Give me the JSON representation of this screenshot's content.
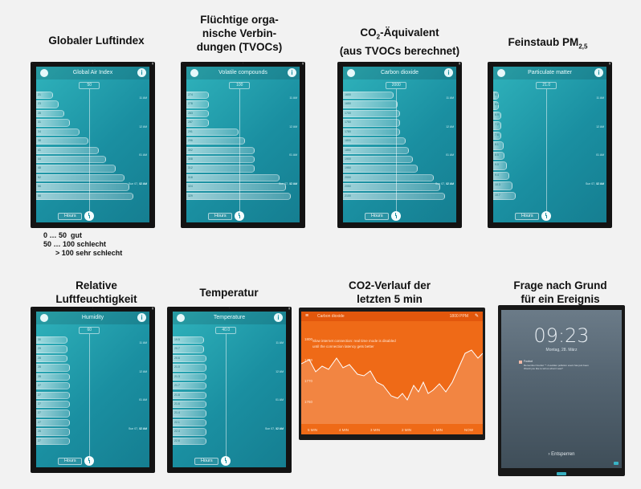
{
  "captions": {
    "c1": "Globaler Luftindex",
    "c2": "Flüchtige orga-\nnische Verbin-\ndungen (TVOCs)",
    "c3_pre": "CO",
    "c3_sub": "2",
    "c3_post": "-Äquivalent\n(aus TVOCs berechnet)",
    "c4_pre": "Feinstaub PM",
    "c4_sub": "2,5",
    "c5": "Relative\nLuftfeuchtigkeit",
    "c6": "Temperatur",
    "c7": "CO2-Verlauf der\nletzten 5 min",
    "c8": "Frage nach Grund\nfür ein Ereignis"
  },
  "legend": "0 … 50  gut\n50 … 100 schlecht\n      > 100 sehr schlecht",
  "screens": [
    {
      "title": "Global Air Index",
      "value": "50",
      "button": "Hours",
      "bars": [
        [
          "21",
          0.15
        ],
        [
          "23",
          0.2
        ],
        [
          "28",
          0.25
        ],
        [
          "31",
          0.3
        ],
        [
          "34",
          0.38
        ],
        [
          "38",
          0.46
        ],
        [
          "41",
          0.55
        ],
        [
          "44",
          0.62
        ],
        [
          "48",
          0.7
        ],
        [
          "52",
          0.78
        ],
        [
          "56",
          0.82
        ],
        [
          "58",
          0.86
        ]
      ],
      "times": [
        "11 AM",
        "12 AM",
        "01 AM",
        "02 AM",
        "Sun 07, 12 AM"
      ]
    },
    {
      "title": "Volatile compounds",
      "value": "100",
      "button": "Hours",
      "bars": [
        [
          "274",
          0.2
        ],
        [
          "278",
          0.2
        ],
        [
          "283",
          0.2
        ],
        [
          "287",
          0.2
        ],
        [
          "291",
          0.46
        ],
        [
          "296",
          0.52
        ],
        [
          "302",
          0.6
        ],
        [
          "308",
          0.6
        ],
        [
          "312",
          0.6
        ],
        [
          "318",
          0.82
        ],
        [
          "324",
          0.88
        ],
        [
          "329",
          0.92
        ]
      ],
      "times": [
        "11 AM",
        "12 AM",
        "01 AM",
        "02 AM",
        "Sun 07, 12 AM"
      ]
    },
    {
      "title": "Carbon dioxide",
      "value": "2000",
      "button": "Hours",
      "bars": [
        [
          "1600",
          0.45
        ],
        [
          "1650",
          0.48
        ],
        [
          "1700",
          0.5
        ],
        [
          "1750",
          0.5
        ],
        [
          "1780",
          0.5
        ],
        [
          "1800",
          0.55
        ],
        [
          "1850",
          0.58
        ],
        [
          "1900",
          0.62
        ],
        [
          "1950",
          0.66
        ],
        [
          "2000",
          0.8
        ],
        [
          "2050",
          0.86
        ],
        [
          "2100",
          0.9
        ]
      ],
      "times": [
        "11 AM",
        "12 AM",
        "01 AM",
        "02 AM",
        "Sun 07, 12 AM"
      ]
    },
    {
      "title": "Particulate matter",
      "value": "21.0",
      "button": "Hours",
      "bars": [
        [
          "5.7",
          0.05
        ],
        [
          "6.4",
          0.05
        ],
        [
          "6.9",
          0.07
        ],
        [
          "7.2",
          0.07
        ],
        [
          "7.6",
          0.07
        ],
        [
          "8.1",
          0.09
        ],
        [
          "8.5",
          0.1
        ],
        [
          "9.0",
          0.12
        ],
        [
          "9.4",
          0.14
        ],
        [
          "10.3",
          0.17
        ],
        [
          "10.7",
          0.2
        ]
      ],
      "times": [
        "11 AM",
        "12 AM",
        "01 AM",
        "02 AM",
        "Sun 07, 12 AM"
      ]
    },
    {
      "title": "Humidity",
      "value": "60",
      "button": "Hours",
      "bars": [
        [
          "30",
          0.28
        ],
        [
          "29",
          0.28
        ],
        [
          "28",
          0.28
        ],
        [
          "28",
          0.3
        ],
        [
          "28",
          0.3
        ],
        [
          "27",
          0.3
        ],
        [
          "27",
          0.3
        ],
        [
          "27",
          0.3
        ],
        [
          "27",
          0.3
        ],
        [
          "27",
          0.3
        ],
        [
          "26",
          0.3
        ],
        [
          "27",
          0.3
        ]
      ],
      "times": [
        "11 AM",
        "12 AM",
        "01 AM",
        "02 AM",
        "Sun 07, 12 AM"
      ]
    },
    {
      "title": "Temperature",
      "value": "40.0",
      "button": "Hours",
      "bars": [
        [
          "19.5",
          0.28
        ],
        [
          "20.7",
          0.28
        ],
        [
          "20.6",
          0.3
        ],
        [
          "21.0",
          0.3
        ],
        [
          "21.3",
          0.3
        ],
        [
          "21.7",
          0.3
        ],
        [
          "21.8",
          0.3
        ],
        [
          "21.6",
          0.3
        ],
        [
          "21.4",
          0.3
        ],
        [
          "22.1",
          0.3
        ],
        [
          "22.4",
          0.3
        ],
        [
          "22.6",
          0.3
        ]
      ],
      "times": [
        "11 AM",
        "12 AM",
        "01 AM",
        "02 AM",
        "Sun 07, 12 AM"
      ]
    }
  ],
  "co2_chart": {
    "header": "Carbon dioxide",
    "header_value": "1800 PPM",
    "notice": "Slow internet connection: real time mode is disabled",
    "notice2": "until the connection latency gets better",
    "y_labels": [
      "1800",
      "1790",
      "1770",
      "1760"
    ],
    "x_labels": [
      "5 MIN",
      "4 MIN",
      "3 MIN",
      "2 MIN",
      "1 MIN",
      "NOW"
    ]
  },
  "lockscreen": {
    "time": "09:23",
    "date": "Montag, 28. März",
    "notif_title": "Foobot",
    "notif_text": "Remember Foobot \"\": A sudden pollution event has just been",
    "notif_text2": "Would you like to tell us what it was?",
    "slide": "› Entsperren"
  }
}
